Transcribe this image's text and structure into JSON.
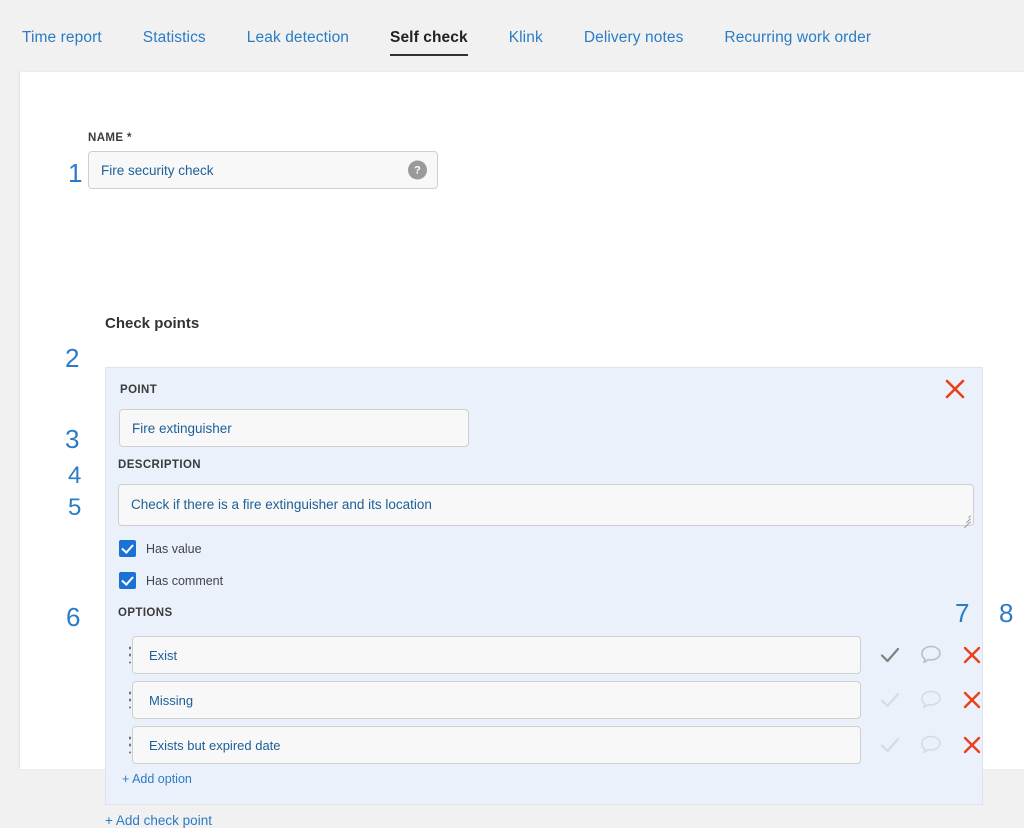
{
  "tabs": [
    {
      "label": "Time report",
      "active": false
    },
    {
      "label": "Statistics",
      "active": false
    },
    {
      "label": "Leak detection",
      "active": false
    },
    {
      "label": "Self check",
      "active": true
    },
    {
      "label": "Klink",
      "active": false
    },
    {
      "label": "Delivery notes",
      "active": false
    },
    {
      "label": "Recurring work order",
      "active": false
    }
  ],
  "form": {
    "name_label": "NAME *",
    "name_value": "Fire security check",
    "help_glyph": "?",
    "checkpoints_title": "Check points"
  },
  "point": {
    "point_label": "POINT",
    "point_value": "Fire extinguisher",
    "description_label": "DESCRIPTION",
    "description_value": "Check if there is a fire extinguisher and its location",
    "has_value_label": "Has value",
    "has_value_checked": true,
    "has_comment_label": "Has comment",
    "has_comment_checked": true,
    "options_label": "OPTIONS",
    "options": [
      {
        "value": "Exist"
      },
      {
        "value": "Missing"
      },
      {
        "value": "Exists but expired date"
      }
    ],
    "add_option_label": "+ Add option"
  },
  "add_checkpoint_label": "+ Add check point",
  "markers": {
    "m1": "1",
    "m2": "2",
    "m3": "3",
    "m4": "4",
    "m5": "5",
    "m6": "6",
    "m7": "7",
    "m8": "8"
  },
  "colors": {
    "link": "#2b7cc4",
    "panel_bg": "#eaf1fa",
    "delete_red": "#e8401c",
    "checkbox_blue": "#1a73d4",
    "input_text": "#1c5f99",
    "page_bg": "#f1f1f1"
  }
}
